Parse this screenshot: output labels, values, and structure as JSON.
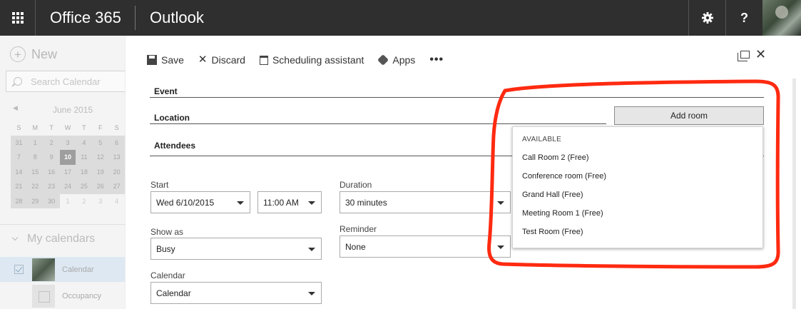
{
  "topbar": {
    "brand": "Office 365",
    "app": "Outlook",
    "settings_icon": "gear-icon",
    "help_label": "?",
    "avatar": "user-avatar"
  },
  "leftpane": {
    "new_label": "New",
    "search_placeholder": "Search Calendar",
    "month_label": "June 2015",
    "weekdays": [
      "S",
      "M",
      "T",
      "W",
      "T",
      "F",
      "S"
    ],
    "weeks": [
      [
        "31",
        "1",
        "2",
        "3",
        "4",
        "5",
        "6"
      ],
      [
        "7",
        "8",
        "9",
        "10",
        "11",
        "12",
        "13"
      ],
      [
        "14",
        "15",
        "16",
        "17",
        "18",
        "19",
        "20"
      ],
      [
        "21",
        "22",
        "23",
        "24",
        "25",
        "26",
        "27"
      ],
      [
        "28",
        "29",
        "30",
        "1",
        "2",
        "3",
        "4"
      ]
    ],
    "today": "10",
    "my_calendars_label": "My calendars",
    "calendars": [
      {
        "label": "Calendar",
        "checked": true
      },
      {
        "label": "Occupancy",
        "checked": false
      }
    ]
  },
  "toolbar": {
    "save_label": "Save",
    "discard_label": "Discard",
    "scheduling_label": "Scheduling assistant",
    "apps_label": "Apps",
    "more_label": "•••"
  },
  "form": {
    "event_label": "Event",
    "location_label": "Location",
    "attendees_label": "Attendees",
    "start_label": "Start",
    "start_date": "Wed 6/10/2015",
    "start_time": "11:00 AM",
    "duration_label": "Duration",
    "duration_value": "30 minutes",
    "show_as_label": "Show as",
    "show_as_value": "Busy",
    "reminder_label": "Reminder",
    "reminder_value": "None",
    "calendar_label": "Calendar",
    "calendar_value": "Calendar"
  },
  "room_picker": {
    "add_room_label": "Add room",
    "header": "AVAILABLE",
    "rooms": [
      "Call Room 2  (Free)",
      "Conference room  (Free)",
      "Grand Hall  (Free)",
      "Meeting Room 1  (Free)",
      "Test Room  (Free)"
    ],
    "highlight_color": "#ff2a10"
  }
}
